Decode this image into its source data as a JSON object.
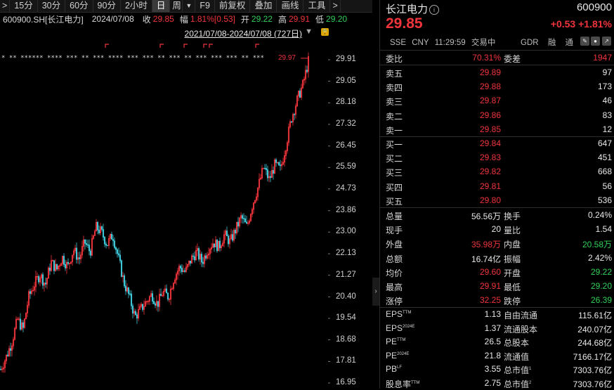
{
  "toolbar": {
    "items": [
      ">",
      "15分",
      "30分",
      "60分",
      "90分",
      "2小时",
      "日",
      "周",
      "F9",
      "前复权",
      "叠加",
      "画线",
      "工具",
      ">"
    ]
  },
  "quote_line": {
    "code": "600900.SH[长江电力]",
    "date": "2024/07/08",
    "close_label": "收",
    "close": "29.85",
    "amp_label": "幅",
    "amp": "1.81%[0.53]",
    "open_label": "开",
    "open": "29.22",
    "high_label": "高",
    "high": "29.91",
    "low_label": "低",
    "low": "29.20"
  },
  "range": {
    "text": "2021/07/08-2024/07/08 (727日)"
  },
  "chart_data": {
    "type": "candlestick",
    "y_ticks": [
      "29.91",
      "29.05",
      "28.18",
      "27.32",
      "26.45",
      "25.59",
      "24.73",
      "23.86",
      "23.00",
      "22.13",
      "21.27",
      "20.40",
      "19.54",
      "18.68",
      "17.81",
      "16.95"
    ],
    "ylim": [
      16.95,
      29.91
    ],
    "high_marker": "29.97",
    "date_range": [
      "2021/07/08",
      "2024/07/08"
    ],
    "trend_close": [
      17.5,
      18.0,
      18.6,
      19.5,
      19.1,
      20.4,
      20.9,
      21.3,
      20.9,
      21.8,
      21.5,
      22.0,
      21.6,
      22.3,
      21.9,
      22.6,
      22.2,
      23.2,
      23.0,
      22.5,
      22.9,
      22.0,
      21.0,
      20.4,
      19.6,
      19.9,
      20.2,
      20.5,
      20.1,
      20.6,
      20.4,
      21.2,
      21.6,
      21.4,
      21.9,
      22.2,
      21.8,
      22.3,
      22.6,
      22.4,
      22.9,
      22.6,
      23.1,
      23.6,
      23.2,
      24.1,
      24.8,
      25.6,
      25.1,
      25.7,
      25.5,
      26.5,
      27.6,
      28.3,
      28.9,
      29.85
    ]
  },
  "panel": {
    "name": "长江电力",
    "code": "600900",
    "price": "29.85",
    "change": "+0.53",
    "change_pct": "+1.81%",
    "meta": [
      "SSE",
      "CNY",
      "11:29:59",
      "交易中"
    ],
    "meta_right": [
      "GDR",
      "融",
      "通"
    ],
    "weibi_label": "委比",
    "weibi": "70.31%",
    "weicha_label": "委差",
    "weicha": "1947",
    "asks": [
      {
        "label": "卖五",
        "price": "29.89",
        "vol": "97"
      },
      {
        "label": "卖四",
        "price": "29.88",
        "vol": "173"
      },
      {
        "label": "卖三",
        "price": "29.87",
        "vol": "46"
      },
      {
        "label": "卖二",
        "price": "29.86",
        "vol": "83"
      },
      {
        "label": "卖一",
        "price": "29.85",
        "vol": "12"
      }
    ],
    "bids": [
      {
        "label": "买一",
        "price": "29.84",
        "vol": "647"
      },
      {
        "label": "买二",
        "price": "29.83",
        "vol": "451"
      },
      {
        "label": "买三",
        "price": "29.82",
        "vol": "668"
      },
      {
        "label": "买四",
        "price": "29.81",
        "vol": "56"
      },
      {
        "label": "买五",
        "price": "29.80",
        "vol": "536"
      }
    ],
    "stats": [
      {
        "l1": "总量",
        "v1": "56.56万",
        "l2": "换手",
        "v2": "0.24%",
        "c1": "white",
        "c2": "white"
      },
      {
        "l1": "现手",
        "v1": "20",
        "l2": "量比",
        "v2": "1.54",
        "c1": "white",
        "c2": "white"
      },
      {
        "l1": "外盘",
        "v1": "35.98万",
        "l2": "内盘",
        "v2": "20.58万",
        "c1": "red",
        "c2": "green"
      },
      {
        "l1": "总额",
        "v1": "16.74亿",
        "l2": "振幅",
        "v2": "2.42%",
        "c1": "white",
        "c2": "white"
      },
      {
        "l1": "均价",
        "v1": "29.60",
        "l2": "开盘",
        "v2": "29.22",
        "c1": "red",
        "c2": "green"
      },
      {
        "l1": "最高",
        "v1": "29.91",
        "l2": "最低",
        "v2": "29.20",
        "c1": "red",
        "c2": "green"
      },
      {
        "l1": "涨停",
        "v1": "32.25",
        "l2": "跌停",
        "v2": "26.39",
        "c1": "red",
        "c2": "green"
      }
    ],
    "fundamentals": [
      {
        "l1": "EPS",
        "s1": "TTM",
        "v1": "1.13",
        "l2": "自由流通",
        "s2": "",
        "v2": "115.61亿"
      },
      {
        "l1": "EPS",
        "s1": "2024E",
        "v1": "1.37",
        "l2": "流通股本",
        "s2": "",
        "v2": "240.07亿"
      },
      {
        "l1": "PE",
        "s1": "TTM",
        "v1": "26.5",
        "l2": "总股本",
        "s2": "",
        "v2": "244.68亿"
      },
      {
        "l1": "PE",
        "s1": "2024E",
        "v1": "21.8",
        "l2": "流通值",
        "s2": "",
        "v2": "7166.17亿"
      },
      {
        "l1": "PB",
        "s1": "LF",
        "v1": "3.55",
        "l2": "总市值",
        "s2": "1",
        "v2": "7303.76亿"
      },
      {
        "l1": "股息率",
        "s1": "TTM",
        "v1": "2.75",
        "l2": "总市值",
        "s2": "2",
        "v2": "7303.76亿"
      }
    ]
  },
  "colors": {
    "up": "#f0343c",
    "down": "#2fd05a",
    "candle_down": "#3ec7d6"
  }
}
